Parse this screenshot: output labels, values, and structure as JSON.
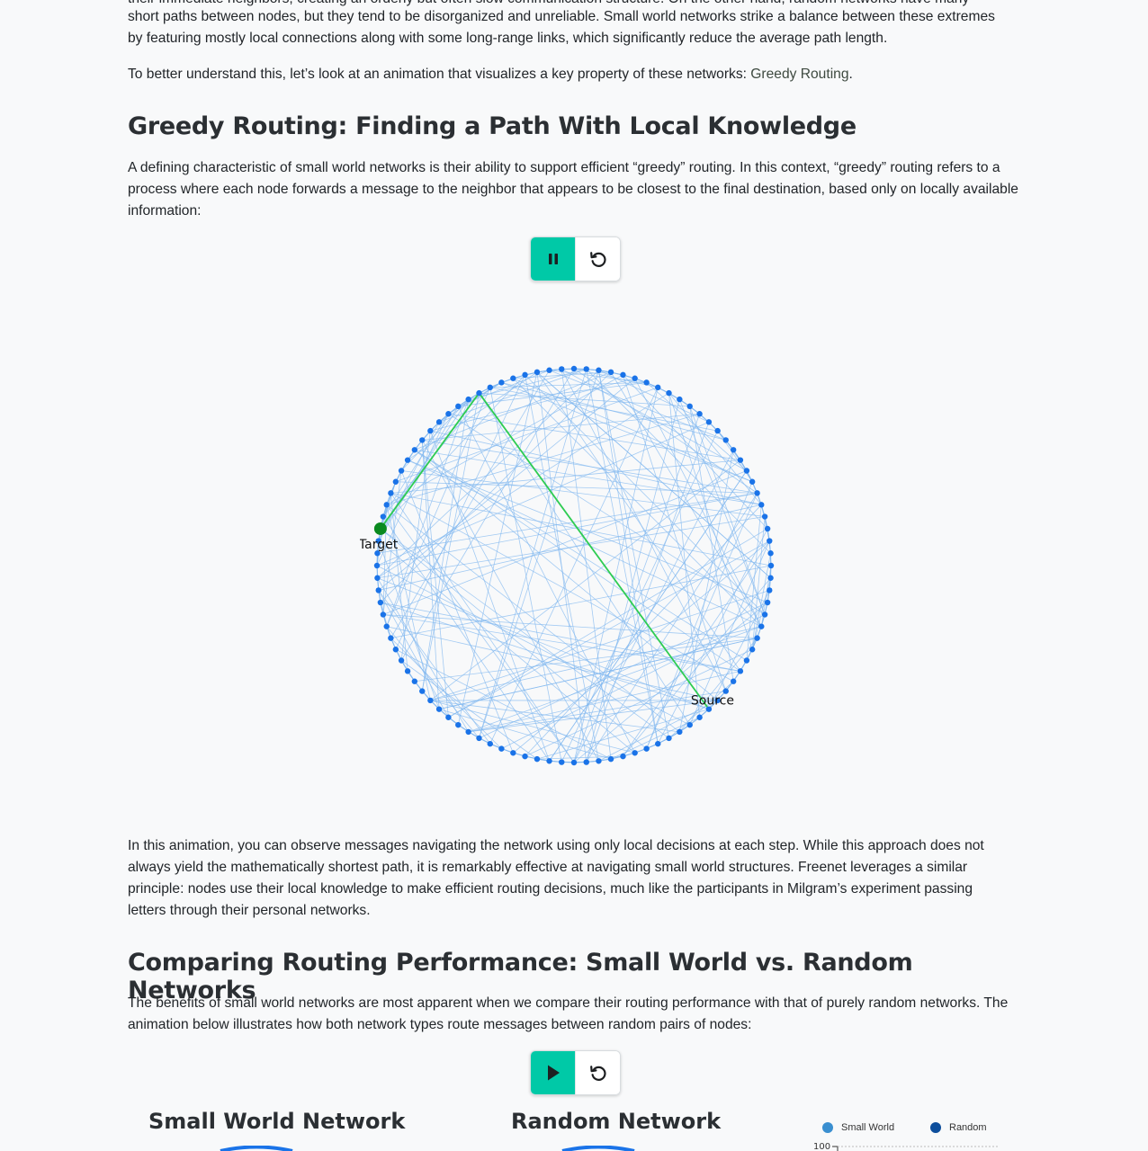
{
  "paragraphs": {
    "p0_line0": "their immediate neighbors, creating an orderly but often slow communication structure. On the other hand, random networks have many",
    "p0_line1": "short paths between nodes, but they tend to be disorganized and unreliable. Small world networks strike a balance between these extremes",
    "p0_line2": "by featuring mostly local connections along with some long-range links, which significantly reduce the average path length.",
    "p1_text": "To better understand this, let’s look at an animation that visualizes a key property of these networks: ",
    "p1_link": "Greedy Routing",
    "p1_end": ".",
    "p2": "A defining characteristic of small world networks is their ability to support efficient “greedy” routing. In this context, “greedy” routing refers to a process where each node forwards a message to the neighbor that appears to be closest to the final destination, based only on locally available information:",
    "p3": "In this animation, you can observe messages navigating the network using only local decisions at each step. While this approach does not always yield the mathematically shortest path, it is remarkably effective at navigating small world structures. Freenet leverages a similar principle: nodes use their local knowledge to make efficient routing decisions, much like the participants in Milgram’s experiment passing letters through their personal networks.",
    "p4": "The benefits of small world networks are most apparent when we compare their routing performance with that of purely random networks. The animation below illustrates how both network types route messages between random pairs of nodes:"
  },
  "headings": {
    "greedy": "Greedy Routing: Finding a Path With Local Knowledge",
    "comparing": "Comparing Routing Performance: Small World vs. Random Networks"
  },
  "greedy_controls": {
    "pause_icon": "pause-icon",
    "reset_icon": "reset-icon"
  },
  "comparison_controls": {
    "play_icon": "play-icon",
    "reset_icon": "reset-icon"
  },
  "network": {
    "node_count": 100,
    "source_label": "Source",
    "target_label": "Target",
    "source_index": 88,
    "target_index": 28,
    "path_indices": [
      88,
      42,
      28
    ],
    "colors": {
      "node": "#1a73e8",
      "edge": "#7fb6f0",
      "path": "#2ecc52",
      "target": "#0a8a1f"
    }
  },
  "comparison": {
    "small_world_title": "Small World Network",
    "random_title": "Random Network",
    "legend": [
      {
        "label": "Small World",
        "color": "#3a8fd0"
      },
      {
        "label": "Random",
        "color": "#0d4e9c"
      }
    ],
    "y_tick_top": "100"
  }
}
